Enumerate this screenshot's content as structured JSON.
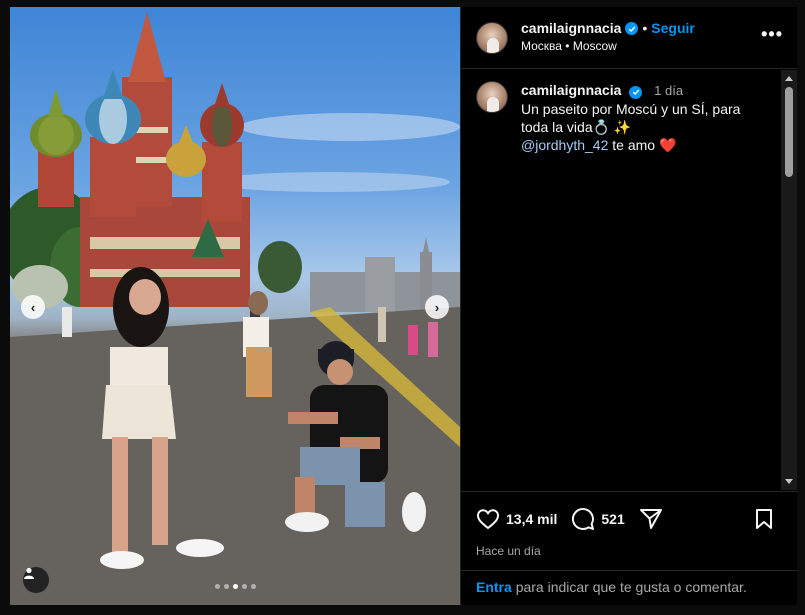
{
  "post": {
    "username": "camilaignnacia",
    "follow_label": "Seguir",
    "header_separator": "•",
    "location": "Москва • Moscow",
    "more_label": "•••"
  },
  "caption": {
    "username": "camilaignnacia",
    "time": "1 día",
    "text": "Un paseito por Moscú y un SÍ, para toda la vida💍 ✨",
    "mention": "@jordhyth_42",
    "text_after_mention": "te amo",
    "heart": "❤️"
  },
  "actions": {
    "likes": "13,4 mil",
    "comments": "521",
    "posted_ago": "Hace un día"
  },
  "login_prompt": {
    "link": "Entra",
    "text": "para indicar que te gusta o comentar."
  },
  "carousel": {
    "total_slides": 5,
    "active_slide": 3
  },
  "colors": {
    "accent": "#0095f6",
    "background": "#000000",
    "mention": "#a7c9f5",
    "heart": "#ff3040"
  },
  "icons": {
    "verified": "verified-badge-icon",
    "like": "heart-outline-icon",
    "comment": "speech-bubble-icon",
    "share": "paper-plane-icon",
    "save": "bookmark-icon",
    "tag": "user-tag-icon",
    "prev": "chevron-left-icon",
    "next": "chevron-right-icon"
  }
}
